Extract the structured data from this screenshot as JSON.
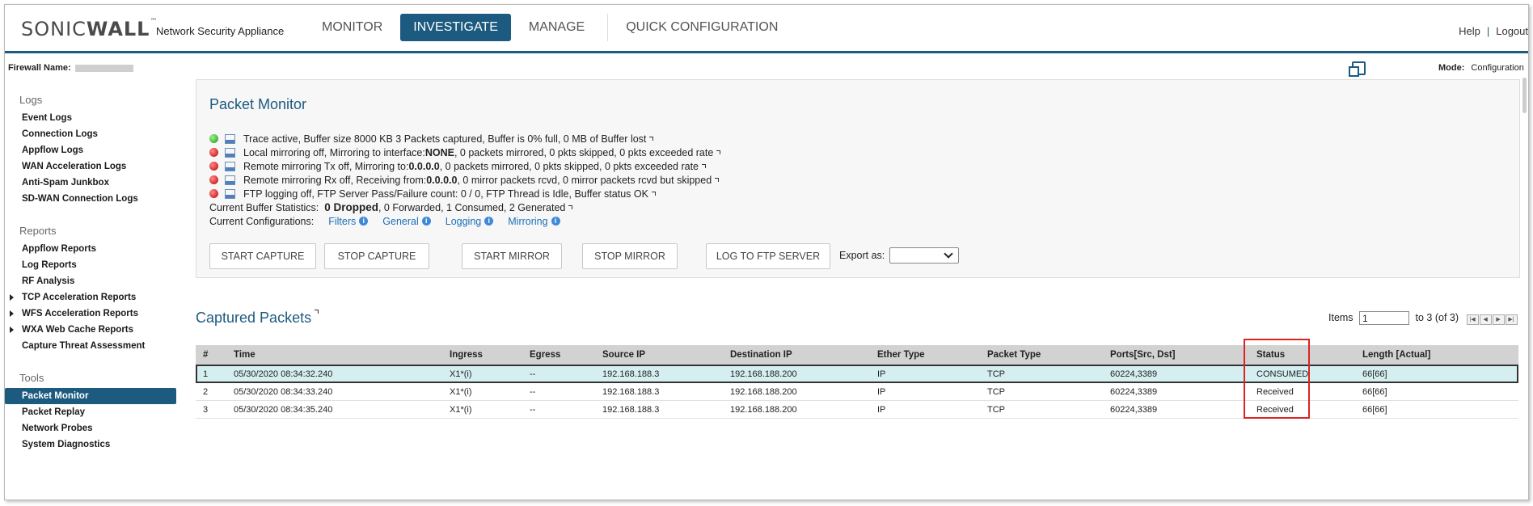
{
  "header": {
    "logo_light": "SONIC",
    "logo_bold": "WALL",
    "logo_tm": "™",
    "app_name": "Network Security Appliance",
    "nav": [
      "MONITOR",
      "INVESTIGATE",
      "MANAGE",
      "QUICK CONFIGURATION"
    ],
    "active_nav": "INVESTIGATE",
    "help": "Help",
    "separator": "|",
    "logout": "Logout"
  },
  "subheader": {
    "firewall_label": "Firewall Name:",
    "mode_label": "Mode:",
    "mode_value": "Configuration"
  },
  "sidebar": {
    "sections": [
      {
        "title": "Logs",
        "items": [
          {
            "label": "Event Logs"
          },
          {
            "label": "Connection Logs"
          },
          {
            "label": "Appflow Logs"
          },
          {
            "label": "WAN Acceleration Logs"
          },
          {
            "label": "Anti-Spam Junkbox"
          },
          {
            "label": "SD-WAN Connection Logs"
          }
        ]
      },
      {
        "title": "Reports",
        "items": [
          {
            "label": "Appflow Reports"
          },
          {
            "label": "Log Reports"
          },
          {
            "label": "RF Analysis"
          },
          {
            "label": "TCP Acceleration Reports",
            "expandable": true
          },
          {
            "label": "WFS Acceleration Reports",
            "expandable": true
          },
          {
            "label": "WXA Web Cache Reports",
            "expandable": true
          },
          {
            "label": "Capture Threat Assessment"
          }
        ]
      },
      {
        "title": "Tools",
        "items": [
          {
            "label": "Packet Monitor",
            "active": true
          },
          {
            "label": "Packet Replay"
          },
          {
            "label": "Network Probes"
          },
          {
            "label": "System Diagnostics"
          }
        ]
      }
    ]
  },
  "packet_monitor": {
    "title": "Packet Monitor",
    "status_lines": [
      {
        "status": "green",
        "text": "Trace active,   Buffer size 8000 KB  3 Packets captured,   Buffer is 0% full,   0 MB of Buffer lost"
      },
      {
        "status": "red",
        "text": "Local mirroring off,   Mirroring to interface:",
        "bold": "NONE",
        "text2": ",   0 packets mirrored,   0 pkts skipped,   0 pkts exceeded rate"
      },
      {
        "status": "red",
        "text": "Remote mirroring Tx off,   Mirroring to: ",
        "bold": "0.0.0.0",
        "text2": ",   0 packets mirrored,   0 pkts skipped,   0 pkts exceeded rate"
      },
      {
        "status": "red",
        "text": "Remote mirroring Rx off,   Receiving from: ",
        "bold": "0.0.0.0",
        "text2": ",   0 mirror packets rcvd,   0 mirror packets rcvd but skipped"
      },
      {
        "status": "red",
        "text": "FTP logging off,   FTP Server Pass/Failure count: 0 / 0,   FTP Thread is Idle,   Buffer status OK"
      }
    ],
    "buffer_stats_label": "Current Buffer Statistics:",
    "buffer_stats_bold": "0 Dropped",
    "buffer_stats_rest": ", 0 Forwarded, 1 Consumed, 2 Generated",
    "config_label": "Current Configurations:",
    "config_links": [
      "Filters",
      "General",
      "Logging",
      "Mirroring"
    ],
    "info_glyph": "i",
    "buttons": [
      "START CAPTURE",
      "STOP CAPTURE",
      "START MIRROR",
      "STOP MIRROR",
      "LOG TO FTP SERVER"
    ],
    "export_label": "Export as:"
  },
  "captured": {
    "title": "Captured Packets",
    "items_label": "Items",
    "items_value": "1",
    "items_range": "to 3 (of 3)",
    "pager": [
      "|◀",
      "◀",
      "▶",
      "▶|"
    ],
    "columns": [
      "#",
      "Time",
      "Ingress",
      "Egress",
      "Source IP",
      "Destination IP",
      "Ether Type",
      "Packet Type",
      "Ports[Src, Dst]",
      "Status",
      "Length [Actual]"
    ],
    "rows": [
      [
        "1",
        "05/30/2020 08:34:32.240",
        "X1*(i)",
        "--",
        "192.168.188.3",
        "192.168.188.200",
        "IP",
        "TCP",
        "60224,3389",
        "CONSUMED",
        "66[66]"
      ],
      [
        "2",
        "05/30/2020 08:34:33.240",
        "X1*(i)",
        "--",
        "192.168.188.3",
        "192.168.188.200",
        "IP",
        "TCP",
        "60224,3389",
        "Received",
        "66[66]"
      ],
      [
        "3",
        "05/30/2020 08:34:35.240",
        "X1*(i)",
        "--",
        "192.168.188.3",
        "192.168.188.200",
        "IP",
        "TCP",
        "60224,3389",
        "Received",
        "66[66]"
      ]
    ],
    "selected_row": 0
  },
  "colors": {
    "brand": "#1c5a80",
    "link": "#1c6fb8",
    "highlight": "#dd2222",
    "selected_row": "#d5eef0"
  }
}
